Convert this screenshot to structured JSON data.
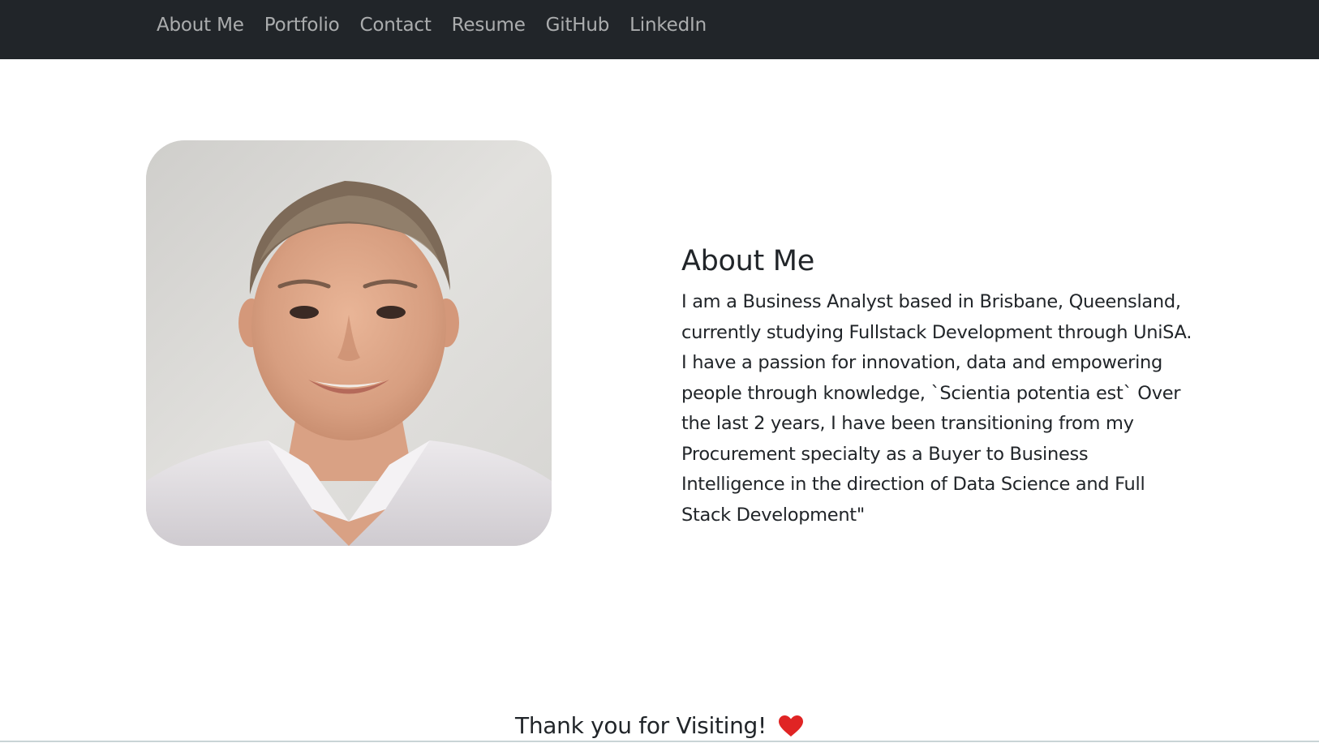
{
  "nav": {
    "items": [
      {
        "label": "About Me"
      },
      {
        "label": "Portfolio"
      },
      {
        "label": "Contact"
      },
      {
        "label": "Resume"
      },
      {
        "label": "GitHub"
      },
      {
        "label": "LinkedIn"
      }
    ]
  },
  "about": {
    "heading": "About Me",
    "body": "I am a Business Analyst based in Brisbane, Queensland, currently studying Fullstack Development through UniSA. I have a passion for innovation, data and empowering people through knowledge, `Scientia potentia est` Over the last 2 years, I have been transitioning from my Procurement specialty as a Buyer to Business Intelligence in the direction of Data Science and Full Stack Development\""
  },
  "footer": {
    "text": "Thank you for Visiting!",
    "icon": "heart-icon",
    "icon_color": "#e02424"
  },
  "colors": {
    "navbar_bg": "#212529",
    "nav_link": "rgba(255,255,255,0.62)",
    "text": "#212529"
  }
}
